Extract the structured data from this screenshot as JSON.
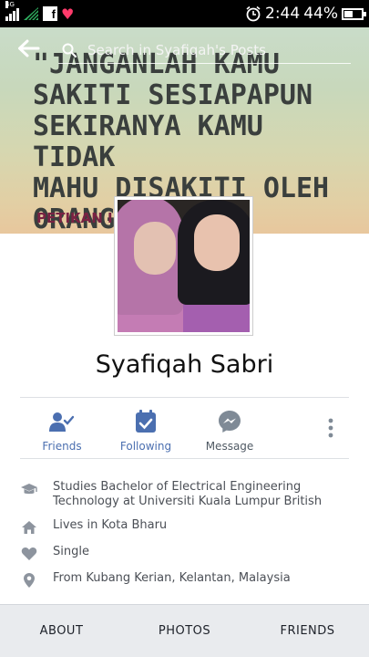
{
  "status_bar": {
    "network": "4G",
    "time": "2:44",
    "battery": "44%",
    "battery_level": 0.44,
    "icons": [
      "signal-icon",
      "wifi-icon",
      "facebook-icon",
      "heart-icon",
      "alarm-icon",
      "battery-icon"
    ]
  },
  "header": {
    "back_icon": "arrow-left-icon",
    "search_placeholder": "Search in Syafiqah's Posts"
  },
  "cover": {
    "quote": "\"JANGANLAH KAMU\nSAKITI SESIAPAPUN\nSEKIRANYA KAMU TIDAK\nMAHU DISAKITI OLEH\nORANG LAIN.\"",
    "credit": "PETIKAN I        HIR"
  },
  "profile": {
    "name": "Syafiqah Sabri"
  },
  "actions": [
    {
      "label": "Friends",
      "icon": "friend-check-icon",
      "color": "#4b6fb0"
    },
    {
      "label": "Following",
      "icon": "following-icon",
      "color": "#4b6fb0"
    },
    {
      "label": "Message",
      "icon": "messenger-icon",
      "color": "#505a64"
    }
  ],
  "more_icon": "more-vertical-icon",
  "info": [
    {
      "icon": "graduation-cap-icon",
      "text": "Studies Bachelor of Electrical Engineering Technology at Universiti Kuala Lumpur British"
    },
    {
      "icon": "home-icon",
      "text": "Lives in Kota Bharu"
    },
    {
      "icon": "heart-icon",
      "text": "Single"
    },
    {
      "icon": "location-pin-icon",
      "text": "From Kubang Kerian, Kelantan, Malaysia"
    }
  ],
  "tabs": [
    "ABOUT",
    "PHOTOS",
    "FRIENDS"
  ],
  "colors": {
    "accent": "#4b6fb0",
    "icon_grey": "#7f8a96",
    "tab_bar": "#e9ebee"
  }
}
